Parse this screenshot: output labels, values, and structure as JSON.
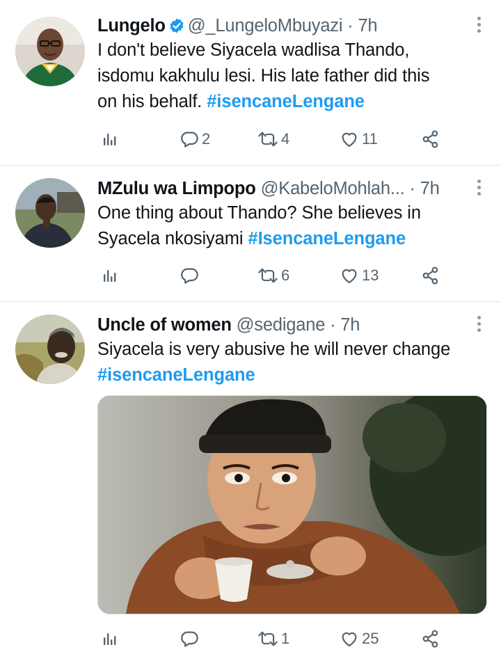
{
  "tweets": [
    {
      "name": "Lungelo",
      "verified": true,
      "handle": "@_LungeloMbuyazi",
      "time": "7h",
      "text_lines": [
        "I don't believe Siyacela wadlisa Thando,",
        "isdomu kakhulu lesi. His late father did this",
        "on his behalf."
      ],
      "hashtag": "#isencaneLengane",
      "replies": "2",
      "retweets": "4",
      "likes": "11"
    },
    {
      "name": "MZulu wa Limpopo",
      "verified": false,
      "handle": "@KabeloMohlah...",
      "time": "7h",
      "text_lines": [
        "One thing about Thando? She believes in",
        "Syacela nkosiyami"
      ],
      "hashtag": "#IsencaneLengane",
      "replies": "",
      "retweets": "6",
      "likes": "13"
    },
    {
      "name": "Uncle of women",
      "verified": false,
      "handle": "@sedigane",
      "time": "7h",
      "text_lines": [
        "Siyacela is very abusive he will never change"
      ],
      "hashtag": "#isencaneLengane",
      "replies": "",
      "retweets": "1",
      "likes": "25"
    }
  ],
  "separator": "·",
  "colors": {
    "text": "#0f1419",
    "secondary": "#536471",
    "link": "#1d9bf0",
    "divider": "#e3e6ea"
  },
  "icons": [
    "views-icon",
    "reply-icon",
    "retweet-icon",
    "like-icon",
    "share-icon",
    "more-icon",
    "verified-icon"
  ]
}
